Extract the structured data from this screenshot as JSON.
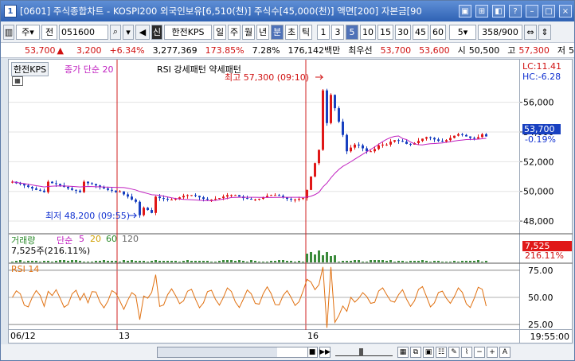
{
  "window": {
    "num": "1",
    "title": "[0601] 주식종합차트 - KOSPI200 외국인보유[6,510(천)] 주식수[45,000(천)] 액면[200] 자본금[90"
  },
  "toolbar": {
    "market": "주",
    "gubun": "전",
    "code": "051600",
    "name_badge": "신",
    "name": "한전KPS",
    "periods": [
      "일",
      "주",
      "월",
      "년",
      "분",
      "초",
      "틱"
    ],
    "selected_period": "분",
    "intervals": [
      "1",
      "3",
      "5",
      "10",
      "15",
      "30",
      "45",
      "60"
    ],
    "selected_interval": "5",
    "count_select": "5",
    "counter": "358/900"
  },
  "info": {
    "price": "53,700",
    "change": "3,200",
    "pct": "+6.34%",
    "volume": "3,277,369",
    "vol_ratio": "173.85%",
    "turnover": "7.28%",
    "amount": "176,142백만",
    "bid_label": "최우선",
    "bid": "53,700",
    "ask": "53,600",
    "open_label": "시",
    "open": "50,500",
    "high_label": "고",
    "high": "57,300",
    "low_label": "저",
    "low": "5"
  },
  "chart": {
    "title": "한전KPS",
    "ma_label": "종가 단순 20",
    "rsi_label": "RSI 강세패턴 약세패턴",
    "high_annot": "최고 57,300 (09:10)",
    "low_annot": "최저 48,200 (09:55)",
    "lc": "LC:11.41",
    "hc": "HC:-6.28",
    "price_tag": "53,700",
    "price_pct": "-0.19%",
    "y_ticks": [
      "56,000",
      "54,000",
      "52,000",
      "50,000",
      "48,000"
    ]
  },
  "volume_panel": {
    "title": "거래량",
    "ma": "단순",
    "ma_vals": [
      "5",
      "20",
      "60",
      "120"
    ],
    "value_text": "7,525주(216.11%)",
    "tag": "7,525",
    "tag_pct": "216.11%"
  },
  "rsi_panel": {
    "title": "RSI 14",
    "ticks": [
      "75.00",
      "50.00",
      "25.00"
    ]
  },
  "x_axis": {
    "labels": [
      "06/12",
      "13",
      "16"
    ],
    "time": "19:55:00"
  },
  "colors": {
    "up": "#e01818",
    "down": "#1840c0",
    "ma": "#c020c0",
    "rsi": "#e07010",
    "title_bar": "#3a6cbf"
  },
  "chart_data": {
    "type": "candlestick",
    "series": [
      {
        "name": "종가 단순 20",
        "values": []
      }
    ],
    "ylim": [
      47200,
      57800
    ],
    "rsi_ylim": [
      20,
      80
    ],
    "high": 57300,
    "low": 48200,
    "last": 53700
  }
}
